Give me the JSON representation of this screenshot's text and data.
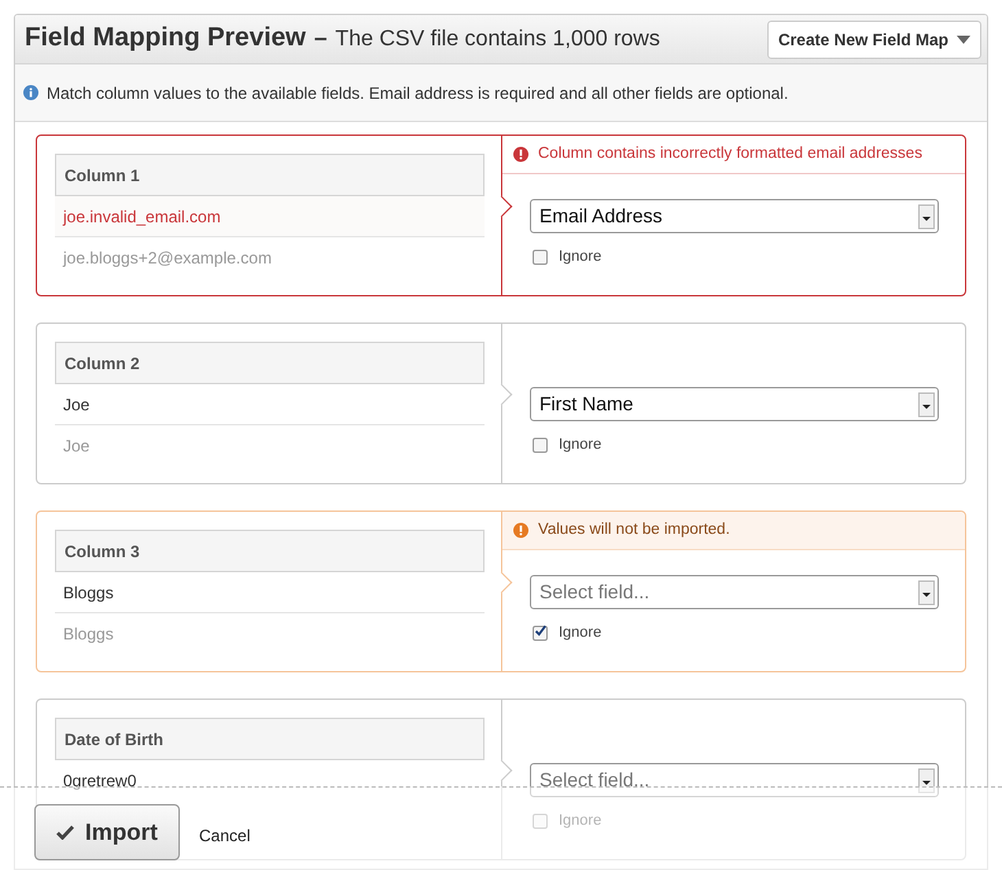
{
  "header": {
    "title": "Field Mapping Preview",
    "separator": "–",
    "subtitle": "The CSV file contains 1,000 rows",
    "menu_button": "Create New Field Map"
  },
  "info": "Match column values to the available fields. Email address is required and all other fields are optional.",
  "columns": [
    {
      "kind": "error",
      "heading": "Column 1",
      "values": [
        {
          "text": "joe.invalid_email.com",
          "invalid": true
        },
        {
          "text": "joe.bloggs+2@example.com",
          "invalid": false
        }
      ],
      "alert": "Column contains incorrectly formatted email addresses",
      "field": {
        "value": "Email Address"
      },
      "ignore": {
        "label": "Ignore",
        "checked": false
      }
    },
    {
      "kind": "normal",
      "heading": "Column 2",
      "values": [
        {
          "text": "Joe",
          "invalid": false
        },
        {
          "text": "Joe",
          "invalid": false
        }
      ],
      "field": {
        "value": "First Name"
      },
      "ignore": {
        "label": "Ignore",
        "checked": false
      }
    },
    {
      "kind": "warning",
      "heading": "Column 3",
      "values": [
        {
          "text": "Bloggs",
          "invalid": false
        },
        {
          "text": "Bloggs",
          "invalid": false
        }
      ],
      "alert": "Values will not be imported.",
      "field": {
        "placeholder": "Select field..."
      },
      "ignore": {
        "label": "Ignore",
        "checked": true
      }
    },
    {
      "kind": "normal",
      "heading": "Date of Birth",
      "values": [
        {
          "text": "0gretrew0",
          "invalid": false
        }
      ],
      "field": {
        "placeholder": "Select field..."
      },
      "ignore": {
        "label": "Ignore",
        "checked": false
      }
    }
  ],
  "footer": {
    "primary": "Import",
    "secondary": "Cancel"
  }
}
